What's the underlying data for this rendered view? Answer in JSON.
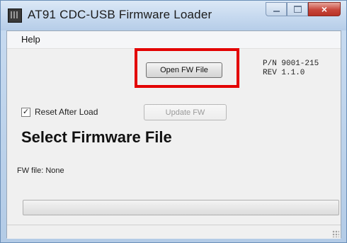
{
  "window": {
    "title": "AT91 CDC-USB Firmware Loader",
    "close_glyph": "×",
    "icons": [
      "app-icon",
      "minimize-icon",
      "maximize-icon",
      "close-icon"
    ]
  },
  "menu": {
    "items": [
      "Help"
    ]
  },
  "buttons": {
    "open_fw_file": "Open FW File",
    "update_fw": "Update FW"
  },
  "part_info": {
    "pn": "P/N 9001-215",
    "rev": "REV 1.1.0"
  },
  "checkbox": {
    "label": "Reset After Load",
    "checked": true,
    "check_glyph": "✓"
  },
  "status": {
    "heading": "Select Firmware File",
    "fw_file": "FW file: None"
  },
  "progress": {
    "value": 0
  },
  "colors": {
    "highlight": "#e30000",
    "close_button": "#c7453a",
    "titlebar": "#c6d9ef"
  }
}
